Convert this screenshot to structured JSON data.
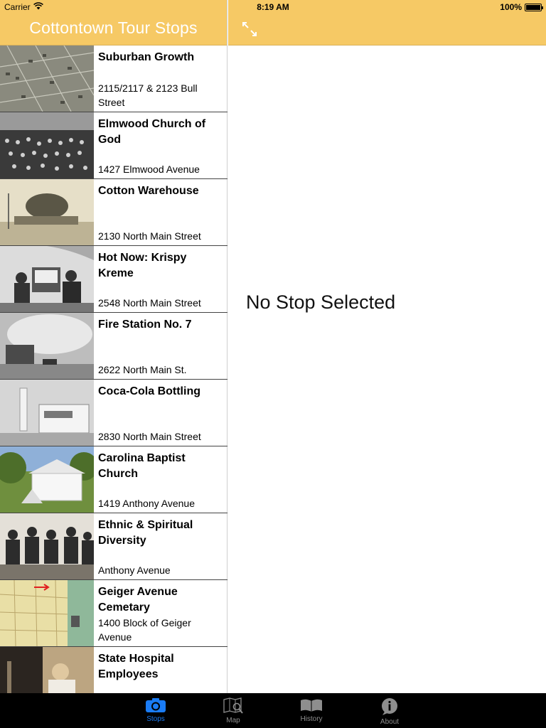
{
  "status": {
    "carrier": "Carrier",
    "time": "8:19 AM",
    "battery": "100%",
    "battery_level": 1.0
  },
  "nav": {
    "title": "Cottontown Tour Stops"
  },
  "stops": [
    {
      "title": "Suburban Growth",
      "address": "2115/2117 & 2123 Bull Street"
    },
    {
      "title": "Elmwood Church of God",
      "address": "1427 Elmwood Avenue"
    },
    {
      "title": "Cotton Warehouse",
      "address": "2130 North Main Street"
    },
    {
      "title": "Hot Now: Krispy Kreme",
      "address": "2548 North Main Street"
    },
    {
      "title": "Fire Station No. 7",
      "address": "2622 North Main St."
    },
    {
      "title": "Coca-Cola Bottling",
      "address": "2830 North Main Street"
    },
    {
      "title": "Carolina Baptist Church",
      "address": "1419 Anthony Avenue"
    },
    {
      "title": "Ethnic & Spiritual Diversity",
      "address": "Anthony Avenue"
    },
    {
      "title": "Geiger Avenue Cemetary",
      "address": "1400 Block of Geiger Avenue"
    },
    {
      "title": "State Hospital Employees",
      "address": ""
    }
  ],
  "detail": {
    "empty_message": "No Stop Selected"
  },
  "tabs": [
    {
      "label": "Stops",
      "icon": "camera-icon",
      "active": true
    },
    {
      "label": "Map",
      "icon": "map-icon",
      "active": false
    },
    {
      "label": "History",
      "icon": "book-icon",
      "active": false
    },
    {
      "label": "About",
      "icon": "info-icon",
      "active": false
    }
  ],
  "colors": {
    "nav_bg": "#f6c965",
    "tab_active": "#1a7cf5",
    "tab_inactive": "#8e8e8e"
  }
}
